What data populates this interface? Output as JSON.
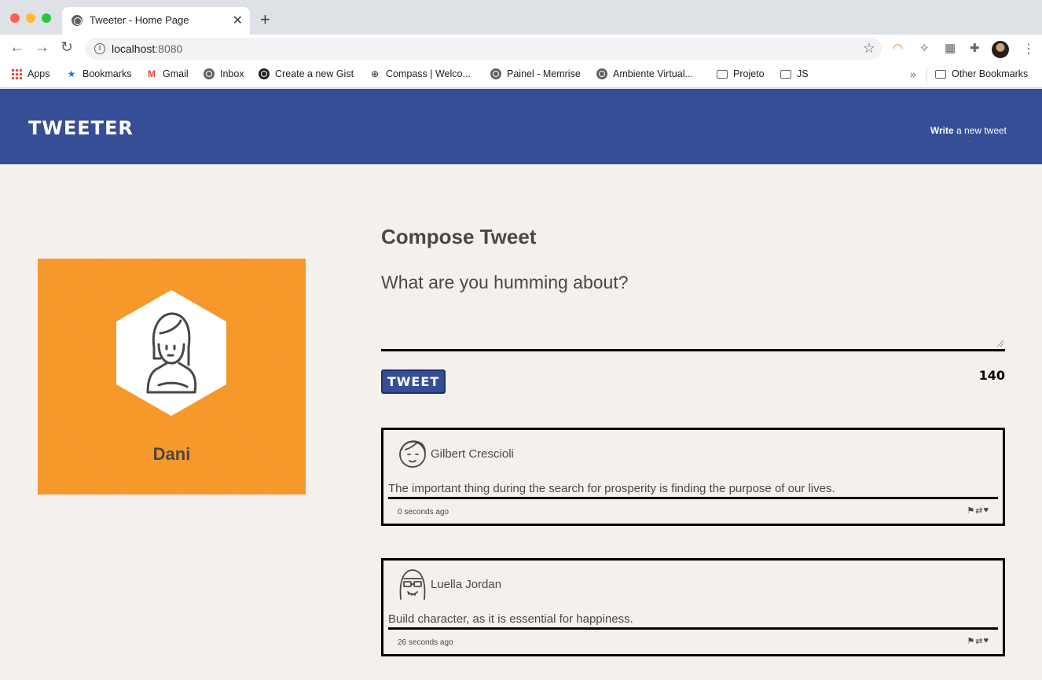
{
  "browser": {
    "tab_title": "Tweeter - Home Page",
    "url_host": "localhost",
    "url_port": ":8080",
    "bookmarks": [
      {
        "label": "Apps",
        "icon": "apps-grid-icon"
      },
      {
        "label": "Bookmarks",
        "icon": "star-icon"
      },
      {
        "label": "Gmail",
        "icon": "gmail-icon"
      },
      {
        "label": "Inbox",
        "icon": "globe-icon"
      },
      {
        "label": "Create a new Gist",
        "icon": "github-icon"
      },
      {
        "label": "Compass | Welco...",
        "icon": "compass-icon"
      },
      {
        "label": "Painel - Memrise",
        "icon": "globe-icon"
      },
      {
        "label": "Ambiente Virtual...",
        "icon": "globe-icon"
      },
      {
        "label": "Projeto",
        "icon": "folder-icon"
      },
      {
        "label": "JS",
        "icon": "folder-icon"
      }
    ],
    "other_bookmarks": "Other Bookmarks"
  },
  "nav": {
    "brand": "TWEETER",
    "write_bold": "Write",
    "write_rest": " a new tweet"
  },
  "profile": {
    "name": "Dani"
  },
  "compose": {
    "title": "Compose Tweet",
    "placeholder": "What are you humming about?",
    "button": "TWEET",
    "counter": "140"
  },
  "tweets": [
    {
      "author": "Gilbert Crescioli",
      "text": "The important thing during the search for prosperity is finding the purpose of our lives.",
      "time": "0 seconds ago"
    },
    {
      "author": "Luella Jordan",
      "text": "Build character, as it is essential for happiness.",
      "time": "26 seconds ago"
    }
  ],
  "colors": {
    "nav_bg": "#354e96",
    "profile_bg": "#f6982a",
    "page_bg": "#f4f1ec",
    "text": "#4a4745"
  }
}
